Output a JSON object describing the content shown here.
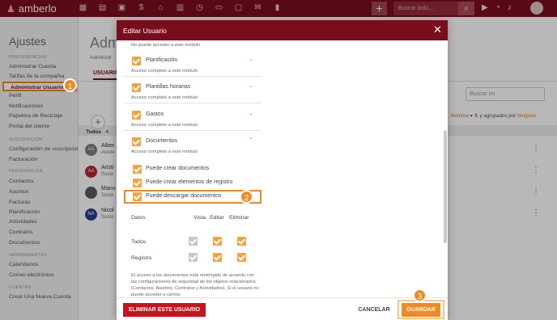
{
  "app": {
    "logo": "amberlo",
    "search_placeholder": "Buscar todo...",
    "nav_icons": [
      "grid-icon",
      "contacts-icon",
      "briefcase-icon",
      "invoice-icon",
      "bank-icon",
      "calendar-icon",
      "timer-icon",
      "folder-icon",
      "report-icon",
      "mail-icon",
      "chart-icon"
    ]
  },
  "sidebar": {
    "title": "Ajustes",
    "sections": [
      {
        "label": "PREFERENCIAS",
        "items": [
          "Administrar Cuenta",
          "Tarifas de la compañía",
          "Administrar Usuarios",
          "Perfil",
          "Notificaciones",
          "Papelera de Reciclaje",
          "Portal del cliente"
        ]
      },
      {
        "label": "SUSCRIPCIÓN",
        "items": [
          "Configuración de suscripción",
          "Facturación"
        ]
      },
      {
        "label": "PERSONALIZA",
        "items": [
          "Contactos",
          "Asuntos",
          "Facturas",
          "Planificación",
          "Actividades",
          "Contratos",
          "Documentos"
        ]
      },
      {
        "label": "HERRAMIENTAS",
        "items": [
          "Calendarios",
          "Correo electrónico"
        ]
      },
      {
        "label": "CUENTAS",
        "items": [
          "Crear Una Nueva Cuenta"
        ]
      }
    ],
    "active_item": "Administrar Usuarios"
  },
  "background": {
    "heading": "Admi",
    "sub": "Administr",
    "tab": "USUARIO",
    "todos_label": "Todos",
    "todos_count": "4",
    "search_placeholder": "Buscar en",
    "sort_field": "Nombre",
    "grouped_label": "y agrupados por",
    "grouped_value": "Ninguno",
    "rows": [
      {
        "initials": "AA",
        "name": "Alber",
        "sub": "Asiste",
        "color": "#7d7d7d"
      },
      {
        "initials": "AA",
        "name": "Aristi",
        "sub": "Socio",
        "color": "#b3262f"
      },
      {
        "initials": "",
        "name": "Manu",
        "sub": "Socio",
        "color": "#5a5a5a"
      },
      {
        "initials": "NA",
        "name": "Nicol",
        "sub": "Socio",
        "color": "#2c3e8a"
      }
    ]
  },
  "modal": {
    "title": "Editar Usuario",
    "top_desc": "No puede acceder a este módulo",
    "modules": [
      {
        "label": "Planificación",
        "desc": "Acceso completo a este módulo",
        "chevron": "⌄"
      },
      {
        "label": "Plantillas horarias",
        "desc": "Acceso completo a este módulo",
        "chevron": "⌄"
      },
      {
        "label": "Gastos",
        "desc": "Acceso completo a este módulo",
        "chevron": "⌄"
      },
      {
        "label": "Documentos",
        "desc": "Acceso completo a este módulo",
        "chevron": "⌃"
      }
    ],
    "permissions": [
      "Puede crear documentos",
      "Puede crear elementos de registro",
      "Puede descargar documentos"
    ],
    "table": {
      "headers": [
        "Datos",
        "Vista",
        "Editar",
        "Eliminar"
      ],
      "rows": [
        {
          "label": "Todos",
          "vista": true,
          "editar": true,
          "eliminar": true
        },
        {
          "label": "Registro",
          "vista": true,
          "editar": true,
          "eliminar": true
        }
      ]
    },
    "note": "El acceso a los documentos está restringido de acuerdo con las configuraciones de seguridad de los objetos relacionados (Contactos, Asuntos, Contratos y Actividades). Si el usuario no puede acceder a ciertos",
    "buttons": {
      "delete": "ELIMINAR ESTE USUARIO",
      "cancel": "CANCELAR",
      "save": "GUARDAR"
    }
  },
  "annotations": {
    "step1": "1",
    "step2": "2",
    "step3": "3",
    "color": "#f08a24"
  }
}
